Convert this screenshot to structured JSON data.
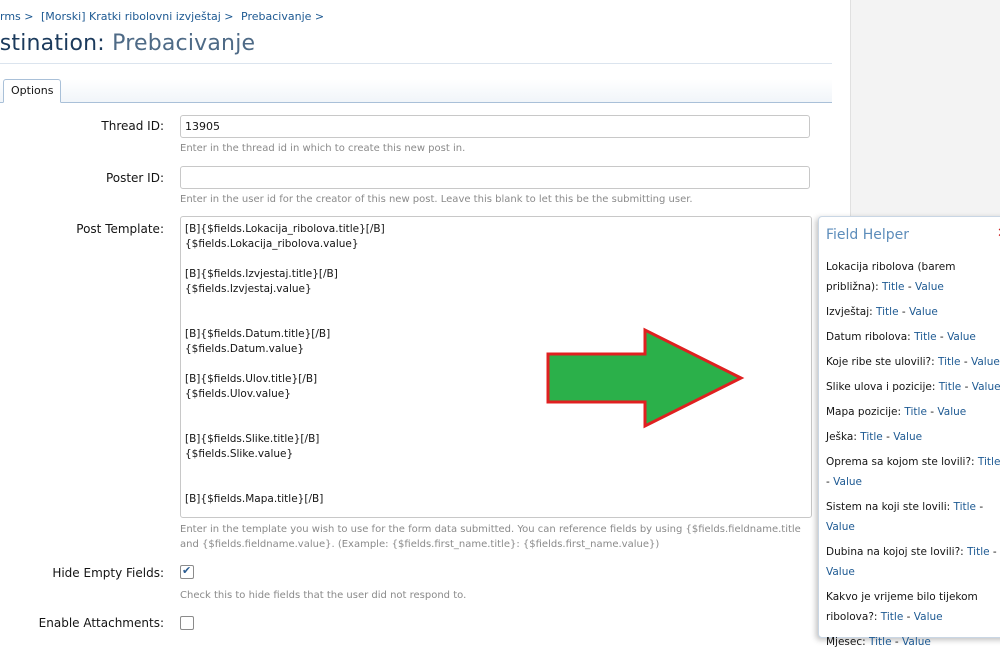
{
  "breadcrumb": {
    "items": [
      "rms >",
      "[Morski] Kratki ribolovni izvještaj >",
      "Prebacivanje >"
    ]
  },
  "title": {
    "prefix": "estination:",
    "name": "Prebacivanje"
  },
  "tabs": [
    {
      "label": "Options"
    }
  ],
  "form": {
    "thread_id": {
      "label": "Thread ID:",
      "value": "13905",
      "hint": "Enter in the thread id in which to create this new post in."
    },
    "poster_id": {
      "label": "Poster ID:",
      "value": "",
      "hint": "Enter in the user id for the creator of this new post. Leave this blank to let this be the submitting user."
    },
    "post_template": {
      "label": "Post Template:",
      "value": "[B]{$fields.Lokacija_ribolova.title}[/B]\n{$fields.Lokacija_ribolova.value}\n\n[B]{$fields.Izvjestaj.title}[/B]\n{$fields.Izvjestaj.value}\n\n\n[B]{$fields.Datum.title}[/B]\n{$fields.Datum.value}\n\n[B]{$fields.Ulov.title}[/B]\n{$fields.Ulov.value}\n\n\n[B]{$fields.Slike.title}[/B]\n{$fields.Slike.value}\n\n\n[B]{$fields.Mapa.title}[/B]",
      "hint_line1": "Enter in the template you wish to use for the form data submitted. You can reference fields by using {$fields.fieldname.title",
      "hint_line2": "and {$fields.fieldname.value}. (Example: {$fields.first_name.title}: {$fields.first_name.value})"
    },
    "hide_empty": {
      "label": "Hide Empty Fields:",
      "checked": true,
      "hint": "Check this to hide fields that the user did not respond to."
    },
    "enable_attachments": {
      "label": "Enable Attachments:",
      "checked": false
    }
  },
  "field_helper": {
    "title": "Field Helper",
    "close_icon": "close-icon",
    "title_link": "Title",
    "value_link": "Value",
    "separator": "-",
    "fields": [
      "Lokacija ribolova (barem približna):",
      "Izvještaj:",
      "Datum ribolova:",
      "Koje ribe ste ulovili?:",
      "Slike ulova i pozicije:",
      "Mapa pozicije:",
      "Ješka:",
      "Oprema sa kojom ste lovili?:",
      "Sistem na koji ste lovili:",
      "Dubina na kojoj ste lovili?:",
      "Kakvo je vrijeme bilo tijekom ribolova?:",
      "Mjesec:"
    ]
  },
  "annotation": {
    "arrow_color": "#2bb04a",
    "arrow_border": "#e02020"
  }
}
